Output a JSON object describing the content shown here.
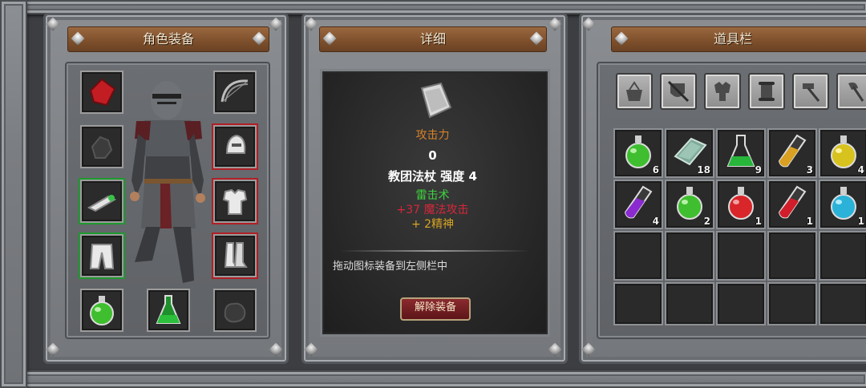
{
  "panels": {
    "equipment": {
      "title": "角色装备"
    },
    "detail": {
      "title": "详细",
      "stat_label": "攻击力",
      "stat_value": "0",
      "item_name": "教团法杖 强度 4",
      "line1": "雷击术",
      "line2": "+37 魔法攻击",
      "line3": "+ 2精神",
      "hint": "拖动图标装备到左侧栏中",
      "unequip_button": "解除装备"
    },
    "inventory": {
      "title": "道具栏"
    }
  },
  "equipment_slots": [
    {
      "icon": "red-cloth-icon"
    },
    {
      "icon": "bow-icon"
    },
    {
      "icon": "gauntlet-icon"
    },
    {
      "icon": "helmet-icon"
    },
    {
      "icon": "bracer-icon"
    },
    {
      "icon": "chest-armor-icon"
    },
    {
      "icon": "pants-icon"
    },
    {
      "icon": "boots-icon"
    },
    {
      "icon": "green-potion-icon"
    },
    {
      "icon": "green-flask-icon"
    },
    {
      "icon": "gloves-icon"
    }
  ],
  "toolbar": [
    {
      "icon": "basket-icon"
    },
    {
      "icon": "shield-sword-icon"
    },
    {
      "icon": "armor-icon"
    },
    {
      "icon": "scroll-icon"
    },
    {
      "icon": "hammer-icon"
    },
    {
      "icon": "axe-icon"
    }
  ],
  "inventory": [
    {
      "icon": "green-potion-icon",
      "count": "6"
    },
    {
      "icon": "metal-ingot-icon",
      "count": "18"
    },
    {
      "icon": "green-flask-icon",
      "count": "9"
    },
    {
      "icon": "orange-vial-icon",
      "count": "3"
    },
    {
      "icon": "yellow-potion-icon",
      "count": "4"
    },
    {
      "icon": "purple-vial-icon",
      "count": "4"
    },
    {
      "icon": "green-potion-icon",
      "count": "2"
    },
    {
      "icon": "red-potion-icon",
      "count": "1"
    },
    {
      "icon": "red-vial-icon",
      "count": "1"
    },
    {
      "icon": "blue-potion-icon",
      "count": "1"
    }
  ],
  "colors": {
    "stat_label": "#d9832a",
    "line1": "#3fd13f",
    "line2": "#d8263a",
    "line3": "#d7a521",
    "banner": "#7d4f2b"
  }
}
